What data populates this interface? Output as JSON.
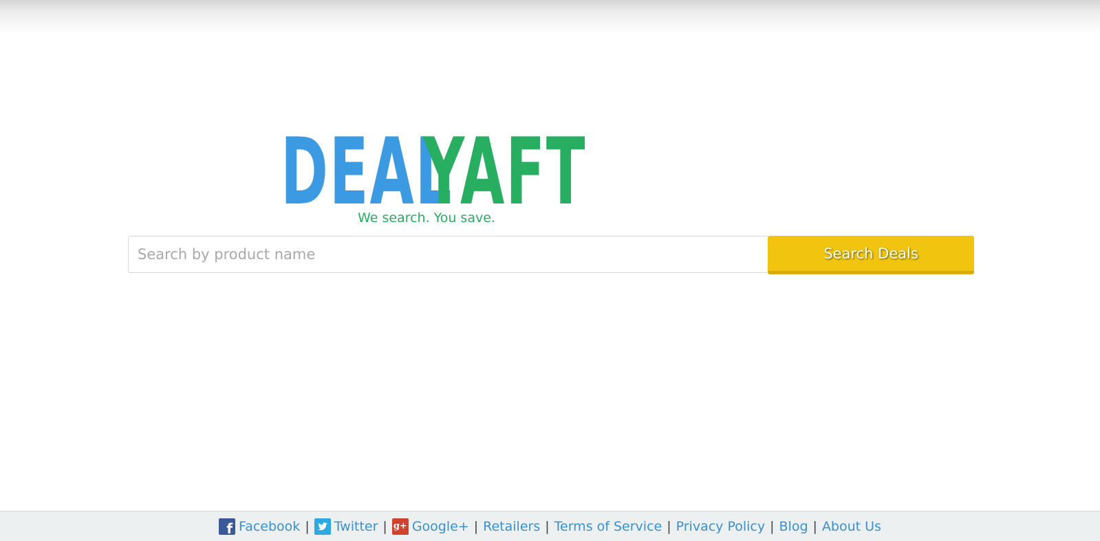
{
  "logo": {
    "part1": "DEAL",
    "part2": "YAFT",
    "part1_color": "#3b9ae1",
    "part2_color": "#27ae60"
  },
  "tagline": "We search. You save.",
  "search": {
    "placeholder": "Search by product name",
    "value": "",
    "button_label": "Search Deals",
    "button_color": "#f1c40f"
  },
  "footer": {
    "links": [
      {
        "label": "Facebook",
        "icon": "facebook-icon"
      },
      {
        "label": "Twitter",
        "icon": "twitter-icon"
      },
      {
        "label": "Google+",
        "icon": "google-plus-icon"
      },
      {
        "label": "Retailers"
      },
      {
        "label": "Terms of Service"
      },
      {
        "label": "Privacy Policy"
      },
      {
        "label": "Blog"
      },
      {
        "label": "About Us"
      }
    ],
    "separator": "|",
    "background": "#ecf0f1",
    "link_color": "#3b8fd4"
  }
}
